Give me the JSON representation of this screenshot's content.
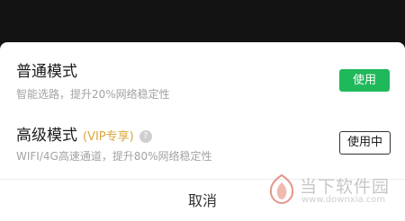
{
  "modes": [
    {
      "title": "普通模式",
      "desc": "智能选路，提升20%网络稳定性",
      "button_label": "使用"
    },
    {
      "title": "高级模式",
      "badge": "(VIP专享)",
      "help_glyph": "?",
      "desc": "WIFI/4G高速通道，提升80%网络稳定性",
      "button_label": "使用中"
    }
  ],
  "cancel_label": "取消",
  "watermark": {
    "name": "当下软件园",
    "url": "www.downxia.com"
  },
  "colors": {
    "accent_green": "#1fb85a",
    "vip_gold": "#d9a63c",
    "backdrop": "#131313"
  }
}
